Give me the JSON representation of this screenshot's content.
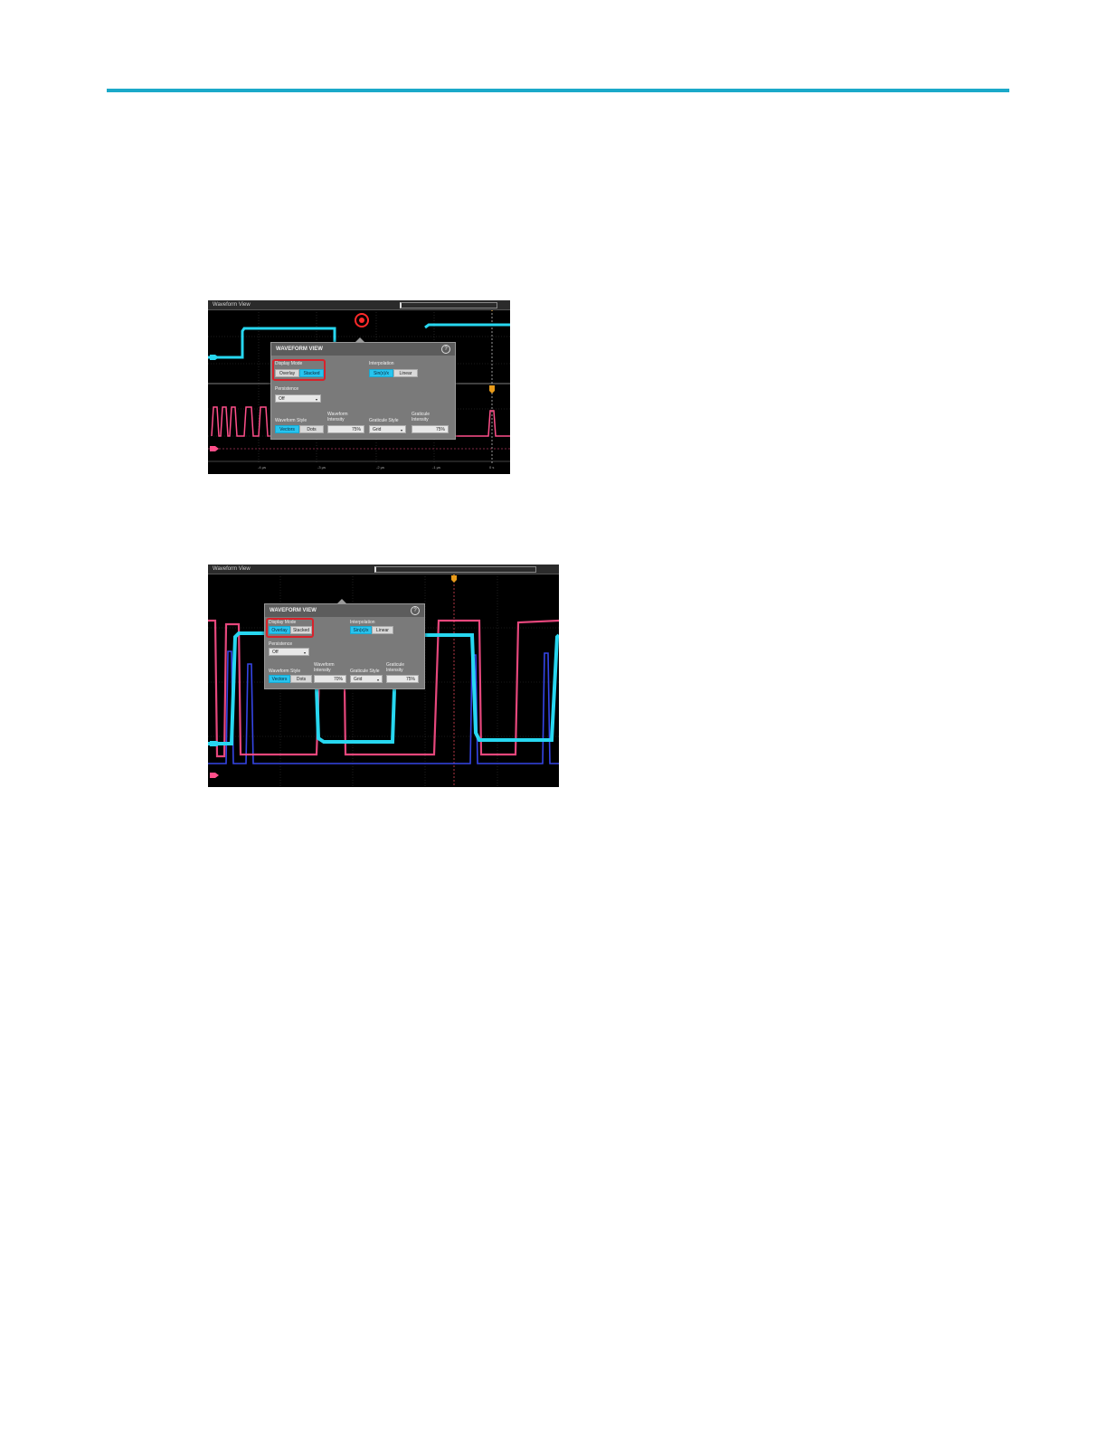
{
  "screens": [
    {
      "window_title": "Waveform View",
      "dialog": {
        "title": "WAVEFORM VIEW",
        "help": "?",
        "display_mode": {
          "label": "Display Mode",
          "options": [
            "Overlay",
            "Stacked"
          ],
          "selected": "Stacked"
        },
        "interpolation": {
          "label": "Interpolation",
          "options": [
            "Sin(x)/x",
            "Linear"
          ],
          "selected": "Sin(x)/x"
        },
        "persistence": {
          "label": "Persistence",
          "value": "Off"
        },
        "waveform_style": {
          "label": "Waveform Style",
          "options": [
            "Vectors",
            "Dots"
          ],
          "selected": "Vectors"
        },
        "waveform_intensity": {
          "label_line1": "Waveform",
          "label_line2": "Intensity",
          "value": "75%"
        },
        "graticule_style": {
          "label": "Graticule Style",
          "value": "Grid"
        },
        "graticule_intensity": {
          "label_line1": "Graticule",
          "label_line2": "Intensity",
          "value": "75%"
        }
      },
      "time_ticks": [
        "-4 µs",
        "-3 µs",
        "-2 µs",
        "-1 µs",
        "0 s"
      ]
    },
    {
      "window_title": "Waveform View",
      "dialog": {
        "title": "WAVEFORM VIEW",
        "help": "?",
        "display_mode": {
          "label": "Display Mode",
          "options": [
            "Overlay",
            "Stacked"
          ],
          "selected": "Overlay"
        },
        "interpolation": {
          "label": "Interpolation",
          "options": [
            "Sin(x)/x",
            "Linear"
          ],
          "selected": "Sin(x)/x"
        },
        "persistence": {
          "label": "Persistence",
          "value": "Off"
        },
        "waveform_style": {
          "label": "Waveform Style",
          "options": [
            "Vectors",
            "Dots"
          ],
          "selected": "Vectors"
        },
        "waveform_intensity": {
          "label_line1": "Waveform",
          "label_line2": "Intensity",
          "value": "70%"
        },
        "graticule_style": {
          "label": "Graticule Style",
          "value": "Grid"
        },
        "graticule_intensity": {
          "label_line1": "Graticule",
          "label_line2": "Intensity",
          "value": "75%"
        }
      }
    }
  ],
  "colors": {
    "accent_rule": "#1ba9c9",
    "channel_1": "#27d7f0",
    "channel_2": "#ff4f8a",
    "channel_3": "#3b4dff",
    "highlight": "#d8222b",
    "selected_button": "#27c4ef"
  }
}
